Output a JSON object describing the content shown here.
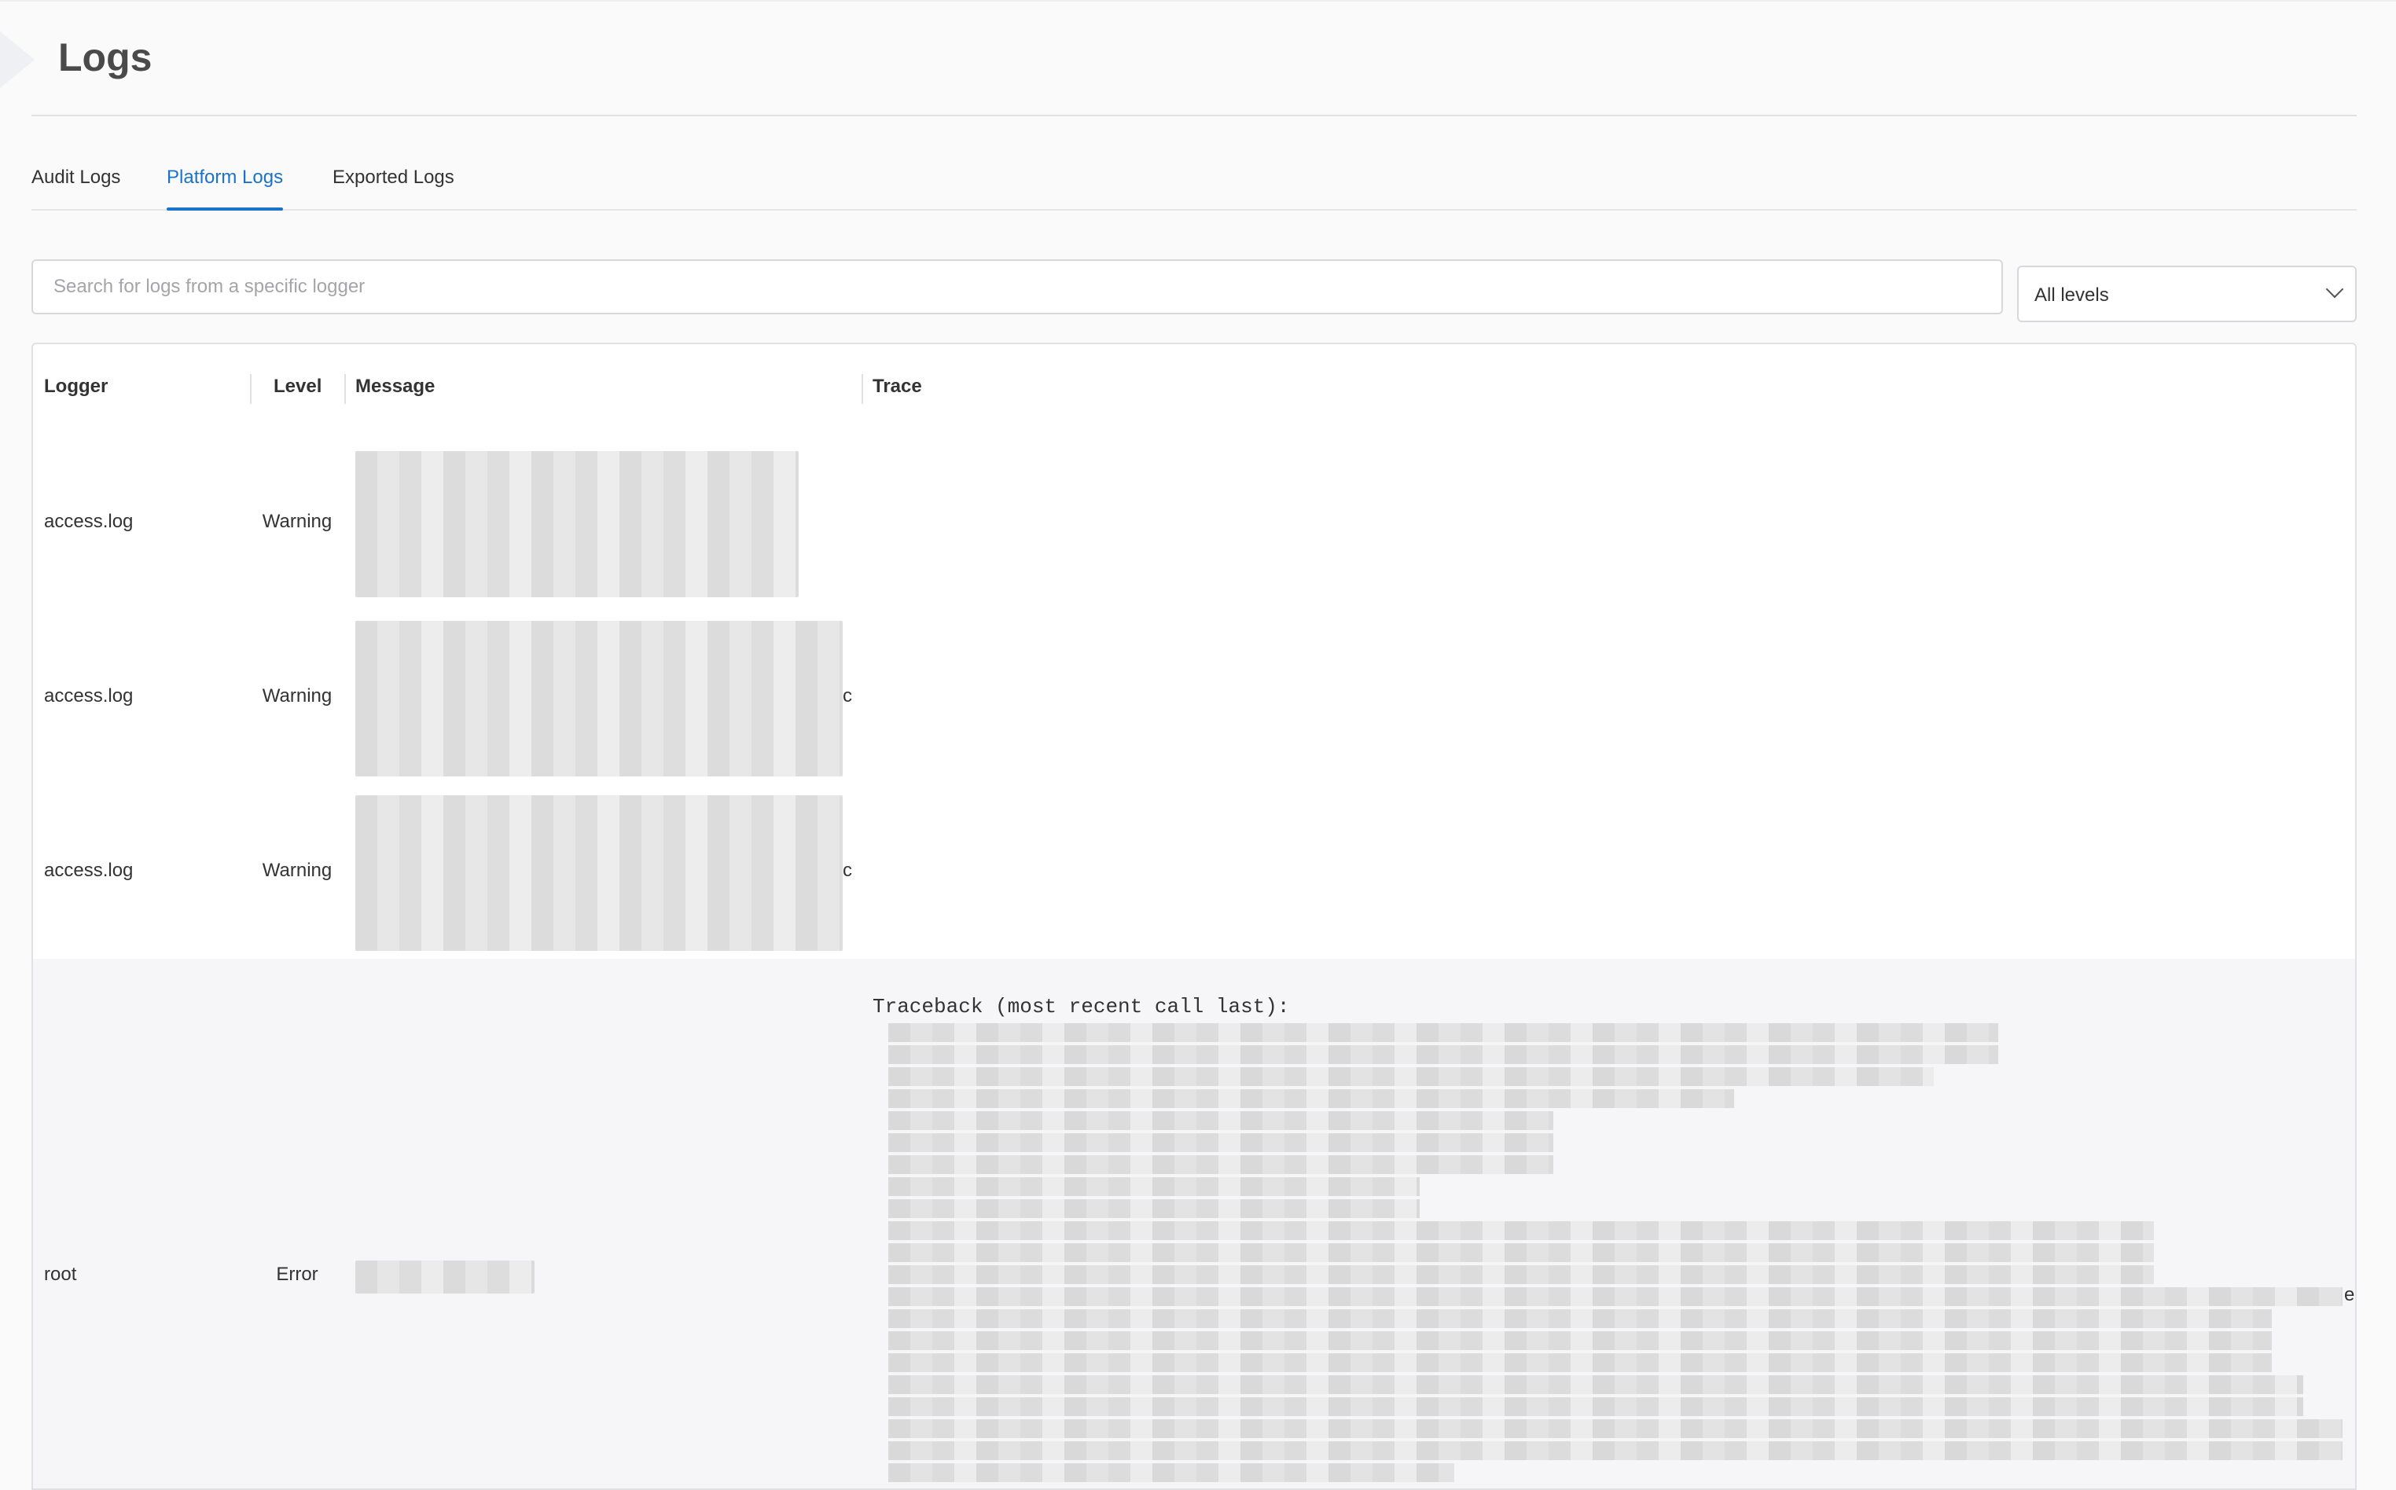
{
  "page": {
    "title": "Logs"
  },
  "tabs": [
    {
      "label": "Audit Logs",
      "active": false
    },
    {
      "label": "Platform Logs",
      "active": true
    },
    {
      "label": "Exported Logs",
      "active": false
    }
  ],
  "filters": {
    "search_placeholder": "Search for logs from a specific logger",
    "search_value": "",
    "level_select": "All levels"
  },
  "table": {
    "columns": [
      "Logger",
      "Level",
      "Message",
      "Trace"
    ],
    "rows": [
      {
        "logger": "access.log",
        "level": "Warning",
        "message_tail": "",
        "trace": ""
      },
      {
        "logger": "access.log",
        "level": "Warning",
        "message_tail": "c",
        "trace": ""
      },
      {
        "logger": "access.log",
        "level": "Warning",
        "message_tail": "c",
        "trace": ""
      },
      {
        "logger": "root",
        "level": "Error",
        "message_tail": "",
        "trace": "Traceback (most recent call last):",
        "trace_tail": "e"
      }
    ]
  },
  "colors": {
    "accent": "#1a73c8",
    "error_row_bg": "#f6f6f8"
  }
}
